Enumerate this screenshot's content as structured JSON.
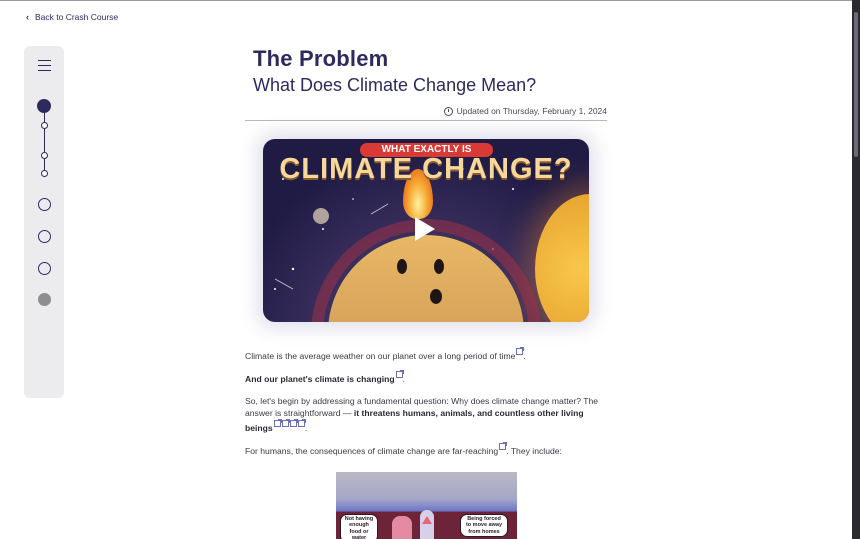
{
  "nav": {
    "back_label": "Back to Crash Course",
    "back_icon": "chevron-left-icon"
  },
  "sidebar": {
    "menu_icon": "hamburger-menu-icon",
    "progress_steps": [
      {
        "state": "current"
      },
      {
        "state": "substep"
      },
      {
        "state": "substep"
      },
      {
        "state": "substep"
      },
      {
        "state": "not-started"
      },
      {
        "state": "not-started"
      },
      {
        "state": "not-started"
      },
      {
        "state": "disabled"
      }
    ]
  },
  "article": {
    "title": "The Problem",
    "subtitle": "What Does Climate Change Mean?",
    "updated": "Updated on Thursday, February 1, 2024",
    "video": {
      "badge": "WHAT EXACTLY IS",
      "headline": "CLIMATE CHANGE?",
      "play_icon": "play-icon"
    },
    "paragraphs": {
      "p1": "Climate is the average weather on our planet over a long period of time",
      "p2": "And our planet's climate is changing",
      "p3_a": "So, let's begin by addressing a fundamental question: Why does climate change matter? The answer is straightforward — ",
      "p3_b": "it threatens humans, animals, and countless other living beings",
      "p4": "For humans, the consequences of climate change are far-reaching",
      "p4_end": ". They include:",
      "period": "."
    },
    "illustration": {
      "label_left": "Not having enough food or water",
      "label_right": "Being forced to move away from homes"
    }
  }
}
